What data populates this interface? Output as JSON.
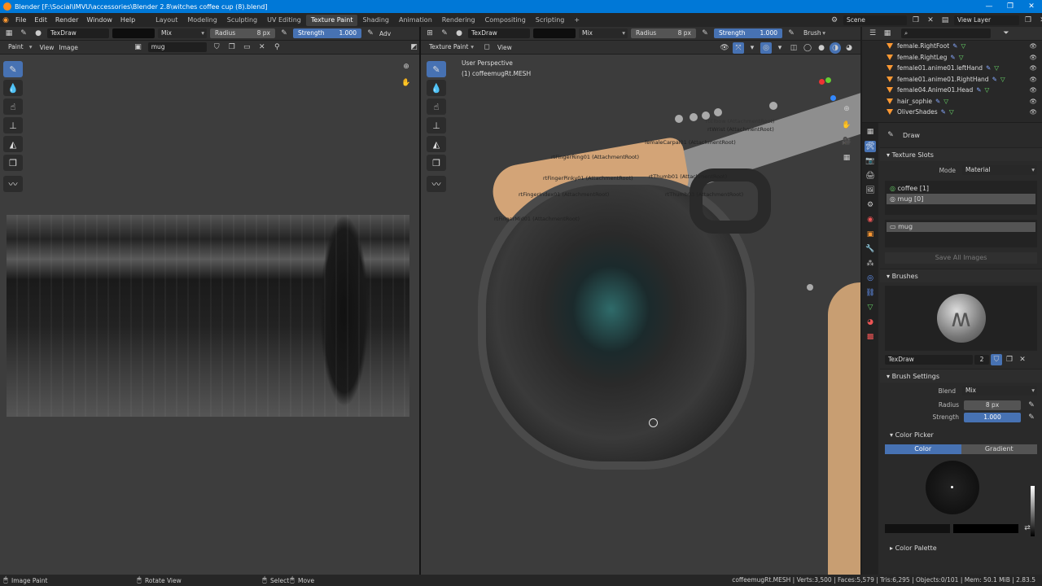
{
  "window": {
    "title": "Blender [F:\\Social\\IMVU\\accessories\\Blender 2.8\\witches coffee cup (8).blend]"
  },
  "menu": [
    "File",
    "Edit",
    "Render",
    "Window",
    "Help"
  ],
  "workspaces": [
    "Layout",
    "Modeling",
    "Sculpting",
    "UV Editing",
    "Texture Paint",
    "Shading",
    "Animation",
    "Rendering",
    "Compositing",
    "Scripting"
  ],
  "active_workspace": "Texture Paint",
  "scene": {
    "name": "Scene",
    "view_layer": "View Layer"
  },
  "left_header": {
    "brush": "TexDraw",
    "blend": "Mix",
    "radius_label": "Radius",
    "radius_value": "8 px",
    "strength_label": "Strength",
    "strength_value": "1.000",
    "adv": "Adv"
  },
  "left_sub": {
    "mode": "Paint",
    "view": "View",
    "image_menu": "Image",
    "image_name": "mug"
  },
  "right_header": {
    "brush": "TexDraw",
    "blend": "Mix",
    "radius_label": "Radius",
    "radius_value": "8 px",
    "strength_label": "Strength",
    "strength_value": "1.000",
    "brush_menu": "Brush"
  },
  "right_sub": {
    "mode": "Texture Paint",
    "view": "View"
  },
  "viewport": {
    "perspective": "User Perspective",
    "object": "(1) coffeemugRt.MESH"
  },
  "outliner": [
    {
      "name": "female.RightFoot"
    },
    {
      "name": "female.RightLeg"
    },
    {
      "name": "female01.anime01.leftHand"
    },
    {
      "name": "female01.anime01.RightHand"
    },
    {
      "name": "female04.Anime01.Head"
    },
    {
      "name": "hair_sophie"
    },
    {
      "name": "OliverShades"
    }
  ],
  "properties": {
    "tool_name": "Draw",
    "texture_slots_title": "Texture Slots",
    "mode_label": "Mode",
    "mode_value": "Material",
    "slots": [
      "coffee [1]",
      "mug [0]"
    ],
    "image_slot": "mug",
    "save_all": "Save All Images",
    "brushes_title": "Brushes",
    "brush_name": "TexDraw",
    "brush_users": "2",
    "brush_settings_title": "Brush Settings",
    "blend_label": "Blend",
    "blend_value": "Mix",
    "radius_label": "Radius",
    "radius_value": "8 px",
    "strength_label": "Strength",
    "strength_value": "1.000",
    "color_picker_title": "Color Picker",
    "color_tab": "Color",
    "gradient_tab": "Gradient",
    "color_palette_title": "Color Palette"
  },
  "status": {
    "left": "Image Paint",
    "middle": "Rotate View",
    "select": "Select",
    "move": "Move",
    "right": "coffeemugRt.MESH | Verts:3,500 | Faces:5,579 | Tris:6,295 | Objects:0/101 | Mem: 50.1 MiB | 2.83.5"
  },
  "annotations": [
    "rtElbow (AttachmentRoot)",
    "rtWrist (AttachmentRoot)",
    "femaleCarpal01 (AttachmentRoot)",
    "rtFingerRing01 (AttachmentRoot)",
    "rtFingerPinky01 (AttachmentRoot)",
    "rtThumb01 (AttachmentRoot)",
    "rtFingerIndex01 (AttachmentRoot)",
    "rtThumb03 (AttachmentRoot)",
    "rtFingerMid01 (AttachmentRoot)"
  ],
  "colors": {
    "accent": "#4772b3",
    "active_ws": "#404040",
    "titlebar": "#0078d7"
  }
}
